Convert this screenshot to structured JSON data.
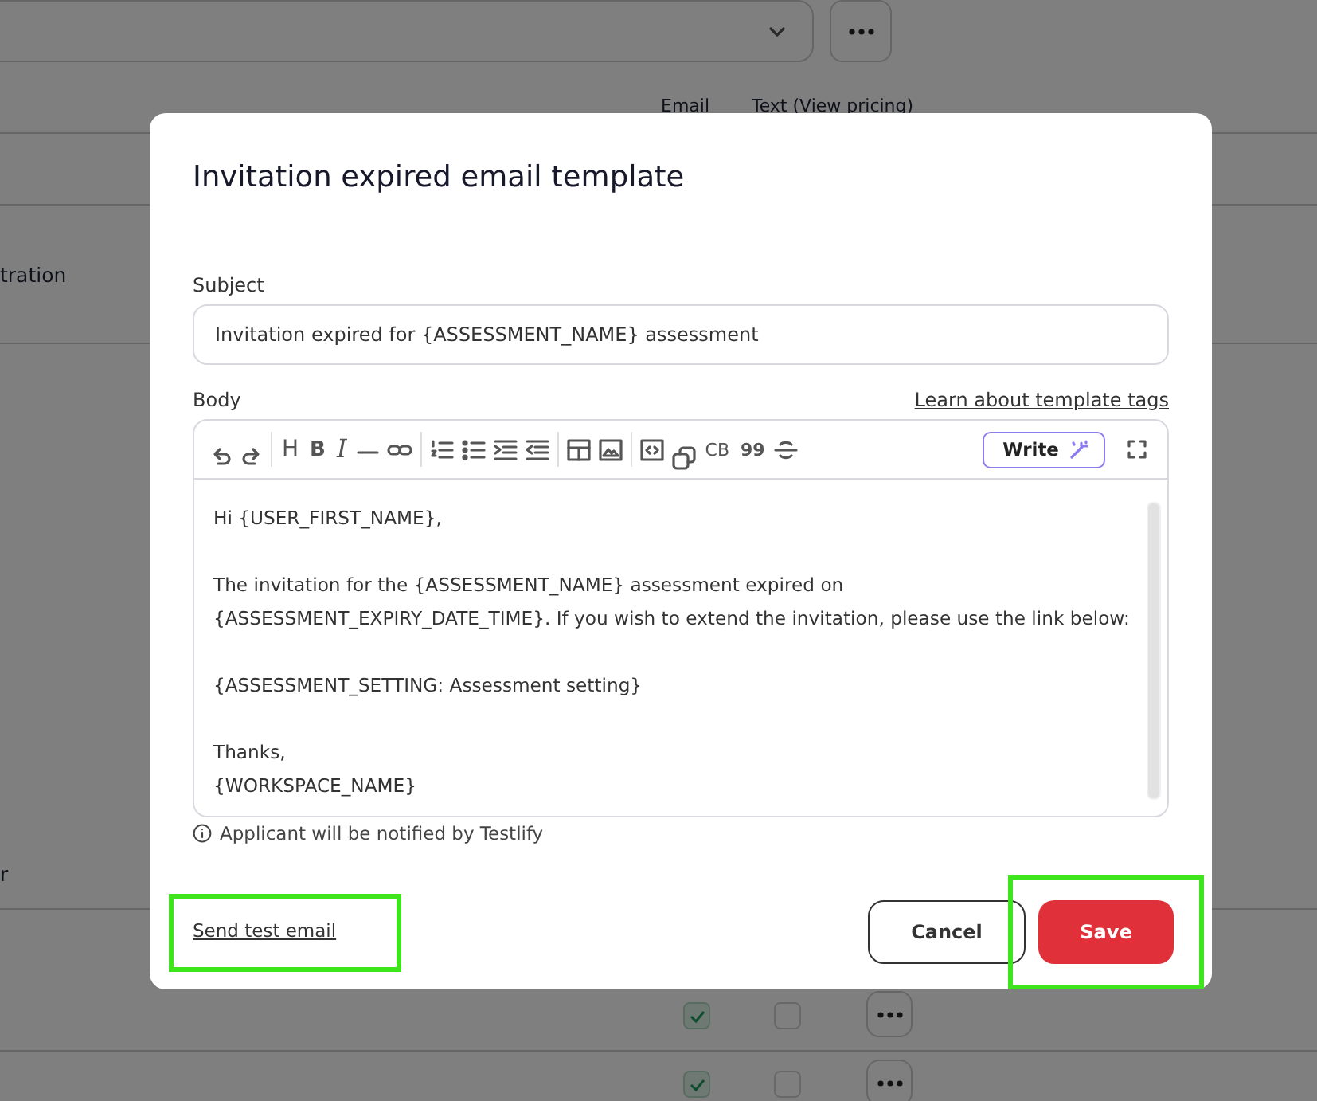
{
  "background": {
    "columns": [
      "Email",
      "Text (View pricing)"
    ],
    "rows": [
      {
        "label": "tration"
      },
      {
        "label": "r"
      },
      {
        "email_checked": true,
        "text_checked": false
      },
      {
        "email_checked": true,
        "text_checked": false
      }
    ]
  },
  "dialog": {
    "title": "Invitation expired email template",
    "subject": {
      "label": "Subject",
      "value": "Invitation expired for {ASSESSMENT_NAME} assessment"
    },
    "body": {
      "label": "Body",
      "help_link": "Learn about template tags",
      "toolbar": [
        [
          {
            "kind": "undo"
          },
          {
            "kind": "redo"
          }
        ],
        [
          {
            "kind": "glyph",
            "label": "H"
          },
          {
            "kind": "bold",
            "label": "B"
          },
          {
            "kind": "italic",
            "label": "I"
          },
          {
            "kind": "rule"
          },
          {
            "kind": "link"
          }
        ],
        [
          {
            "kind": "ordered"
          },
          {
            "kind": "bullets"
          },
          {
            "kind": "indent"
          },
          {
            "kind": "outdent"
          }
        ],
        [
          {
            "kind": "table"
          },
          {
            "kind": "image"
          }
        ],
        [
          {
            "kind": "code"
          },
          {
            "kind": "copy"
          },
          {
            "kind": "glyph",
            "label": "CB"
          },
          {
            "kind": "bold",
            "label": "99"
          },
          {
            "kind": "strike"
          }
        ]
      ],
      "write_button": "Write",
      "paragraphs": [
        [
          "Hi {USER_FIRST_NAME},"
        ],
        [
          "The invitation for the {ASSESSMENT_NAME} assessment expired on",
          "{ASSESSMENT_EXPIRY_DATE_TIME}. If you wish to extend the invitation, please use the link below:"
        ],
        [
          "{ASSESSMENT_SETTING: Assessment setting}"
        ],
        [
          "Thanks,",
          "{WORKSPACE_NAME}"
        ]
      ]
    },
    "note": "Applicant will be notified by Testlify",
    "send_test": {
      "label": "Send test email",
      "highlighted": true
    },
    "buttons": [
      {
        "label": "Cancel",
        "kind": "secondary",
        "highlighted": false
      },
      {
        "label": "Save",
        "kind": "primary",
        "highlighted": true
      }
    ]
  }
}
